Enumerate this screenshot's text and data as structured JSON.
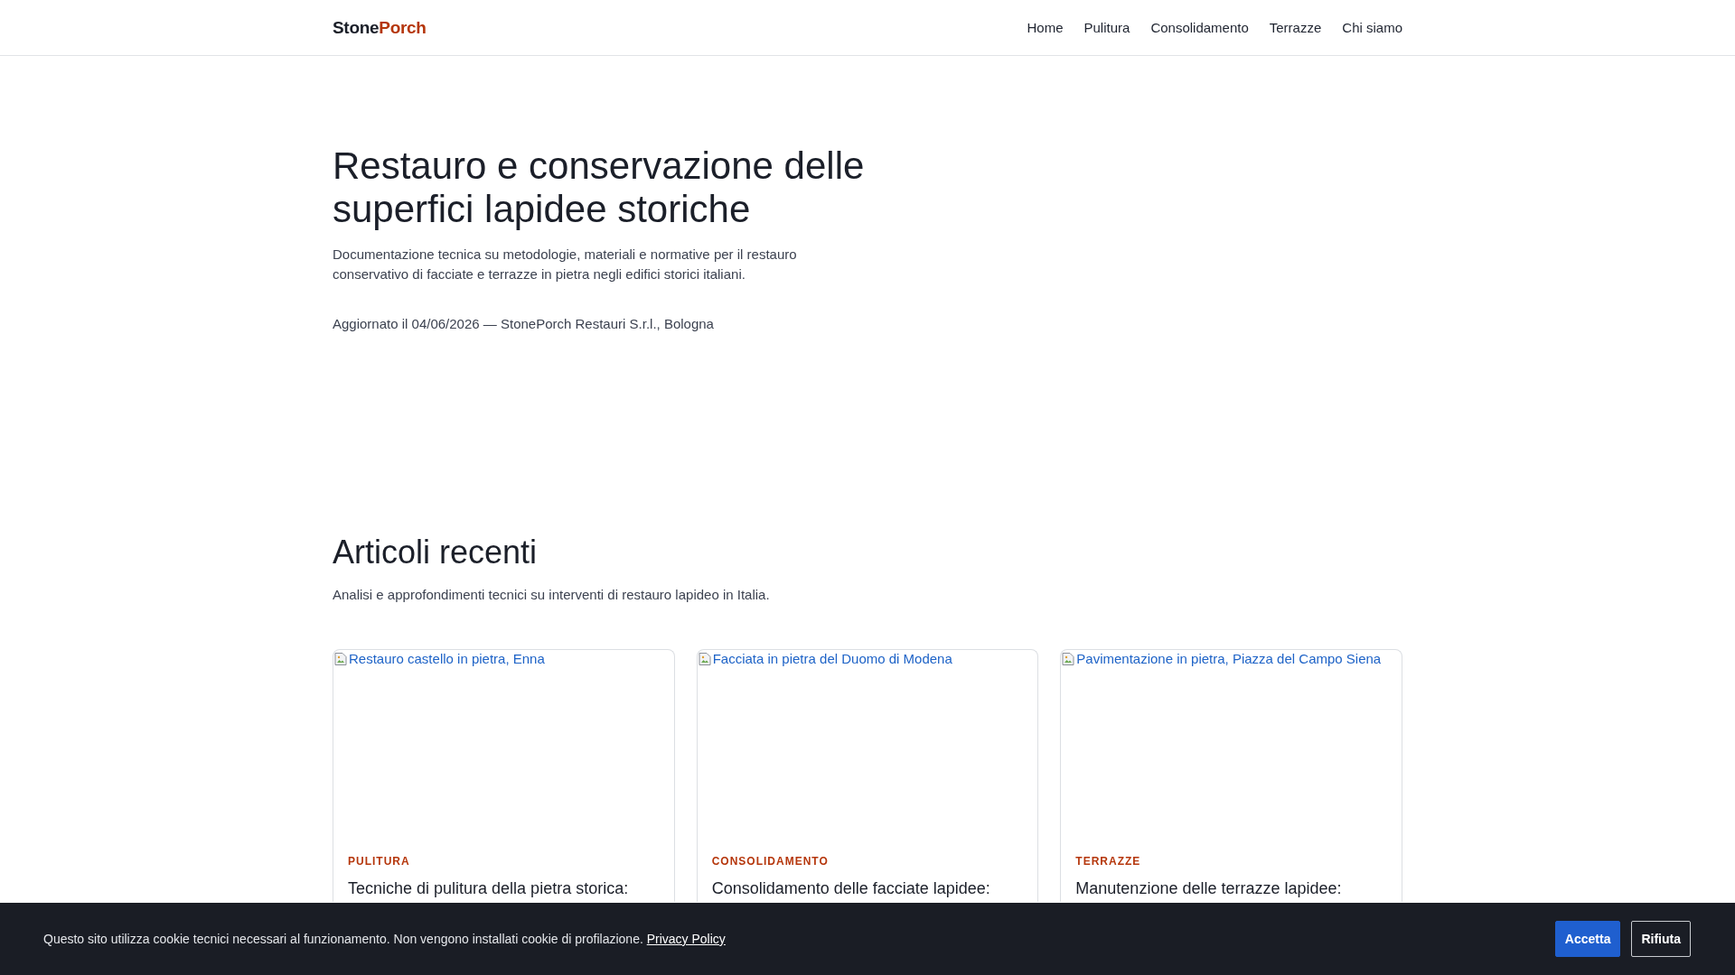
{
  "header": {
    "logo": {
      "part_1": "Stone",
      "part_2": "Porch"
    },
    "nav": [
      {
        "label": "Home"
      },
      {
        "label": "Pulitura"
      },
      {
        "label": "Consolidamento"
      },
      {
        "label": "Terrazze"
      },
      {
        "label": "Chi siamo"
      }
    ]
  },
  "hero": {
    "title": "Restauro e conservazione delle superfici lapidee storiche",
    "description": "Documentazione tecnica su metodologie, materiali e normative per il restauro conservativo di facciate e terrazze in pietra negli edifici storici italiani.",
    "meta": "Aggiornato il 04/06/2026 — StonePorch Restauri S.r.l., Bologna"
  },
  "articles": {
    "title": "Articoli recenti",
    "subtitle": "Analisi e approfondimenti tecnici su interventi di restauro lapideo in Italia.",
    "cards": [
      {
        "image_alt": "Restauro castello in pietra, Enna",
        "category": "PULITURA",
        "title": "Tecniche di pulitura della pietra storica:"
      },
      {
        "image_alt": "Facciata in pietra del Duomo di Modena",
        "category": "CONSOLIDAMENTO",
        "title": "Consolidamento delle facciate lapidee:"
      },
      {
        "image_alt": "Pavimentazione in pietra, Piazza del Campo Siena",
        "category": "TERRAZZE",
        "title": "Manutenzione delle terrazze lapidee:"
      }
    ]
  },
  "cookie_banner": {
    "text": "Questo sito utilizza cookie tecnici necessari al funzionamento. Non vengono installati cookie di profilazione.",
    "link": "Privacy Policy",
    "buttons": [
      {
        "label": "Accetta",
        "kind": "primary"
      },
      {
        "label": "Rifiuta",
        "kind": "secondary"
      }
    ]
  }
}
